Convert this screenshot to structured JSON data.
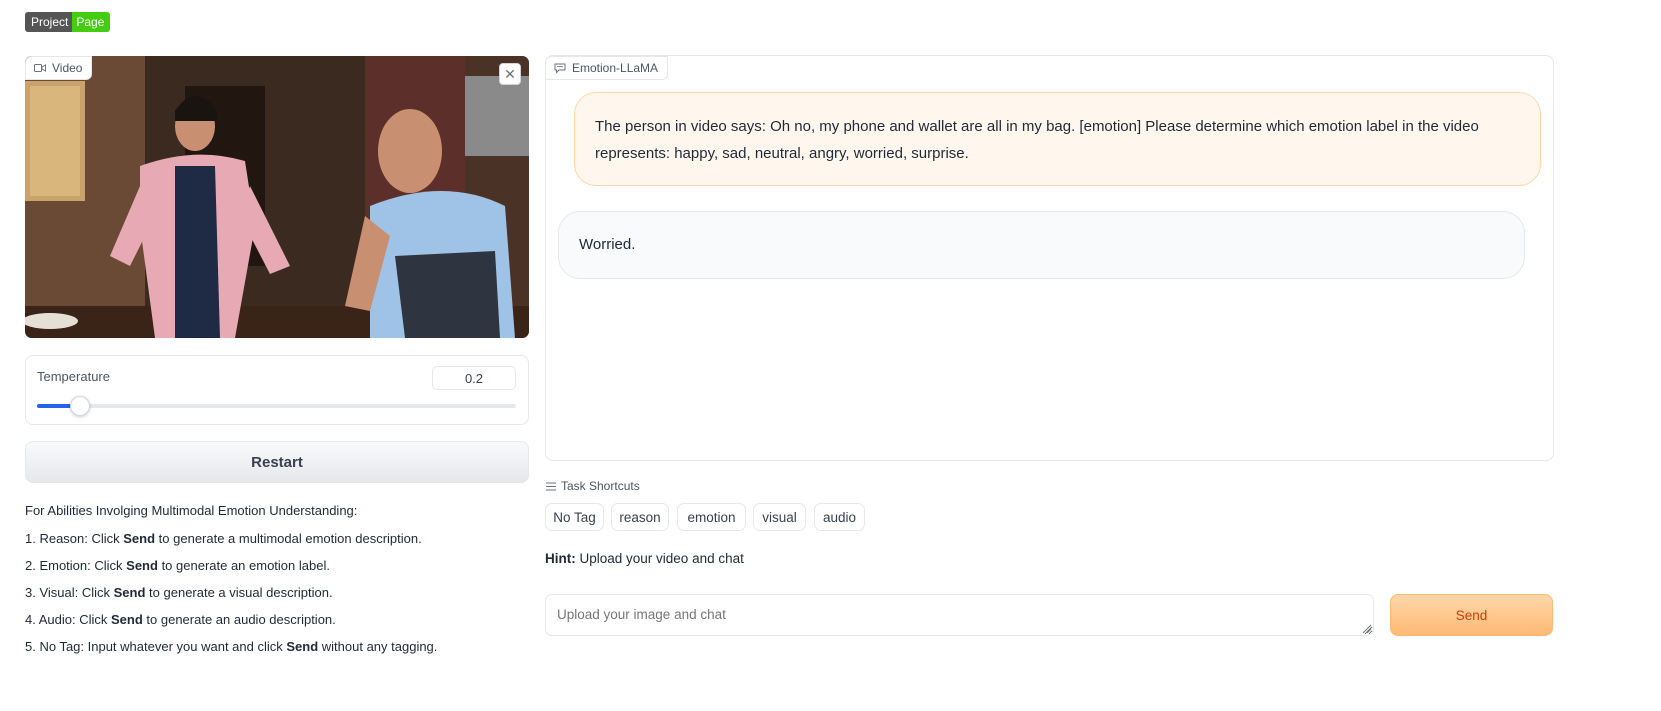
{
  "badge": {
    "left": "Project",
    "right": "Page"
  },
  "video": {
    "label": "Video",
    "close_icon": "close-icon"
  },
  "temperature": {
    "label": "Temperature",
    "value": "0.2",
    "slider_fraction": 0.09
  },
  "restart_label": "Restart",
  "instructions": {
    "heading": "For Abilities Involging Multimodal Emotion Understanding:",
    "items": [
      {
        "pre": "1. Reason: Click ",
        "bold": "Send",
        "post": " to generate a multimodal emotion description."
      },
      {
        "pre": "2. Emotion: Click ",
        "bold": "Send",
        "post": " to generate an emotion label."
      },
      {
        "pre": "3. Visual: Click ",
        "bold": "Send",
        "post": " to generate a visual description."
      },
      {
        "pre": "4. Audio: Click ",
        "bold": "Send",
        "post": " to generate an audio description."
      },
      {
        "pre": "5. No Tag: Input whatever you want and click ",
        "bold": "Send",
        "post": " without any tagging."
      }
    ]
  },
  "chatbot": {
    "label": "Emotion-LLaMA",
    "messages": [
      {
        "role": "user",
        "text": "The person in video says: Oh no, my phone and wallet are all in my bag. [emotion] Please determine which emotion label in the video represents: happy, sad, neutral, angry, worried, surprise."
      },
      {
        "role": "bot",
        "text": "Worried."
      }
    ]
  },
  "task_shortcuts": {
    "label": "Task Shortcuts",
    "chips": [
      "No Tag",
      "reason",
      "emotion",
      "visual",
      "audio"
    ]
  },
  "hint": {
    "bold": "Hint:",
    "text": " Upload your video and chat"
  },
  "input": {
    "placeholder": "Upload your image and chat"
  },
  "send_label": "Send",
  "colors": {
    "accent_blue": "#2563eb",
    "send_orange": "#fdba74",
    "user_bubble": "#fff7ed",
    "badge_green": "#44cc11"
  }
}
